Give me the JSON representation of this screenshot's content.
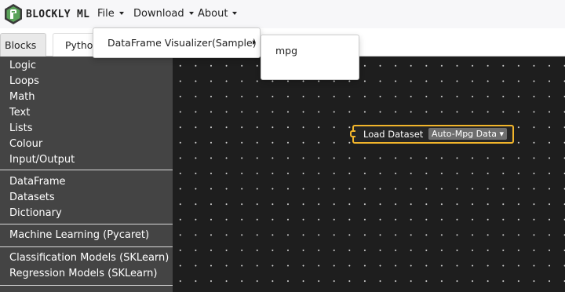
{
  "brand": {
    "name": "BLOCKLY ML",
    "logo_icon": "blockly-ml-logo-icon"
  },
  "navbar": {
    "menus": [
      {
        "label": "File",
        "has_caret": true
      },
      {
        "label": "Download",
        "has_caret": true
      },
      {
        "label": "About",
        "has_caret": true
      }
    ]
  },
  "tabs": [
    {
      "label": "Blocks",
      "active": true
    },
    {
      "label": "Python",
      "active": false
    }
  ],
  "file_menu": {
    "items": [
      {
        "label": "DataFrame Visualizer(Sample)",
        "has_submenu": true
      }
    ],
    "submenu_items": [
      {
        "label": "mpg"
      }
    ]
  },
  "toolbox": {
    "groups": [
      [
        "Logic",
        "Loops",
        "Math",
        "Text",
        "Lists",
        "Colour",
        "Input/Output"
      ],
      [
        "DataFrame",
        "Datasets",
        "Dictionary"
      ],
      [
        "Machine Learning (Pycaret)"
      ],
      [
        "Classification Models (SKLearn)",
        "Regression Models (SKLearn)"
      ]
    ]
  },
  "workspace": {
    "block": {
      "label": "Load Dataset",
      "dropdown_value": "Auto-Mpg Data",
      "dropdown_caret": "▾",
      "color": "#f2b52b"
    }
  },
  "colors": {
    "navbar_bg": "#f7f7f9",
    "toolbox_bg": "#444444",
    "workspace_bg": "#1e1e1e",
    "block_border": "#f2b52b"
  }
}
